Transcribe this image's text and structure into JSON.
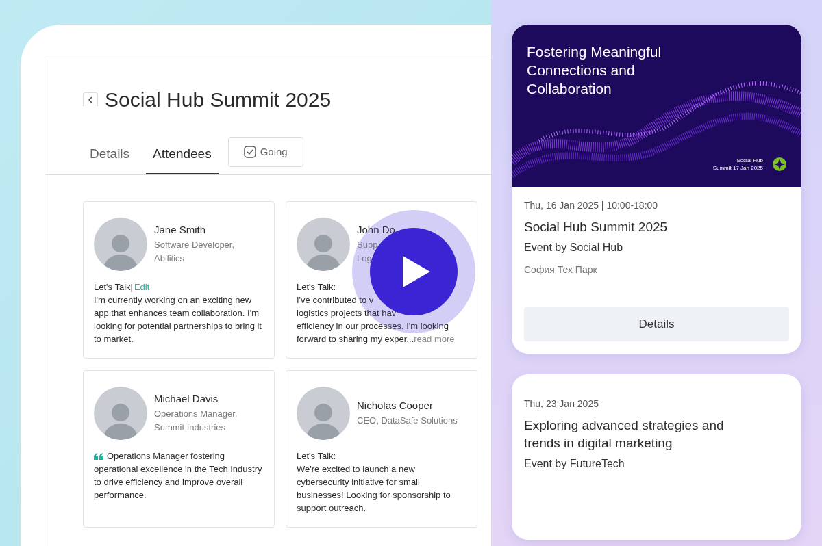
{
  "event": {
    "title": "Social Hub Summit 2025"
  },
  "tabs": [
    {
      "label": "Details",
      "selected": false
    },
    {
      "label": "Attendees",
      "selected": true
    }
  ],
  "going_button": {
    "label": "Going",
    "checked": true
  },
  "attendees": [
    {
      "kind": "talk",
      "name": "Jane Smith",
      "role": [
        "Software Developer,",
        "Abilitics"
      ],
      "talk_label": "Let's Talk|",
      "edit_link": "Edit",
      "body": "I'm currently working on an exciting new app that enhances team collaboration. I'm looking for potential partnerships to bring it to market."
    },
    {
      "kind": "covered",
      "name": "John Do",
      "role": [
        "Supp",
        "Log"
      ],
      "talk_label": "Let's Talk:",
      "lines": [
        "I've contributed to v",
        "logistics projects that hav",
        "efficiency in our processes. I'm looking",
        "forward to sharing my exper..."
      ],
      "read_more": "read more"
    },
    {
      "kind": "quote",
      "name": "Michael Davis",
      "role": [
        "Operations Manager,",
        "Summit Industries"
      ],
      "body": "Operations Manager fostering operational excellence in the Tech Industry to drive efficiency and improve overall performance."
    },
    {
      "kind": "talk",
      "name": "Nicholas Cooper",
      "role": [
        "CEO, DataSafe Solutions"
      ],
      "talk_label": "Let's Talk:",
      "body": "We're excited to launch a new cybersecurity initiative for small businesses! Looking for sponsorship to support outreach."
    }
  ],
  "event_cards": [
    {
      "kind": "banner",
      "banner_title": "Fostering Meaningful Connections and Collaboration",
      "banner_caption": [
        "Social Hub",
        "Summit 17 Jan 2025"
      ],
      "date": "Thu, 16 Jan 2025 | 10:00-18:00",
      "title": "Social Hub Summit 2025",
      "organizer": "Event by Social Hub",
      "location": "София Тех Парк",
      "button": "Details"
    },
    {
      "kind": "plain",
      "date": "Thu, 23 Jan 2025",
      "title": "Exploring advanced strategies and trends in digital marketing",
      "organizer": "Event by FutureTech"
    }
  ]
}
